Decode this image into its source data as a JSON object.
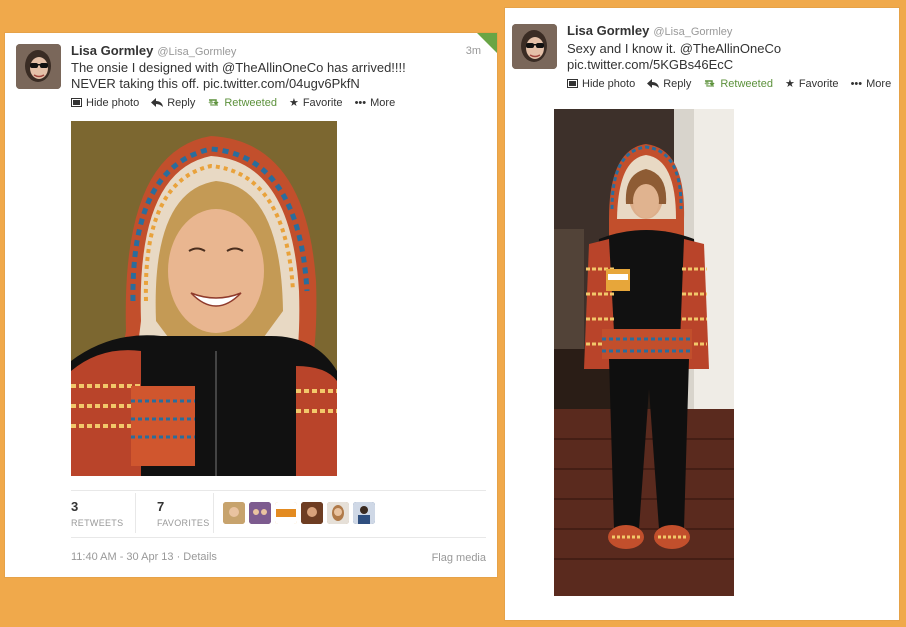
{
  "tweet1": {
    "name": "Lisa Gormley",
    "handle": "@Lisa_Gormley",
    "time": "3m",
    "text_line1": "The onsie I designed with @TheAllinOneCo has arrived!!!!",
    "text_line2": "NEVER taking this off. pic.twitter.com/04ugv6PkfN",
    "actions": {
      "hide_photo": "Hide photo",
      "reply": "Reply",
      "retweeted": "Retweeted",
      "favorite": "Favorite",
      "more": "More"
    },
    "stats": {
      "retweets_count": "3",
      "retweets_label": "RETWEETS",
      "favorites_count": "7",
      "favorites_label": "FAVORITES"
    },
    "meta": "11:40 AM - 30 Apr 13 · Details",
    "flag": "Flag media"
  },
  "tweet2": {
    "name": "Lisa Gormley",
    "handle": "@Lisa_Gormley",
    "text_line1": "Sexy and I know it. @TheAllinOneCo",
    "text_line2": "pic.twitter.com/5KGBs46EcC",
    "actions": {
      "hide_photo": "Hide photo",
      "reply": "Reply",
      "retweeted": "Retweeted",
      "favorite": "Favorite",
      "more": "More"
    }
  },
  "colors": {
    "background": "#f0a94b",
    "retweeted_green": "#5c913b",
    "muted_text": "#999999"
  }
}
